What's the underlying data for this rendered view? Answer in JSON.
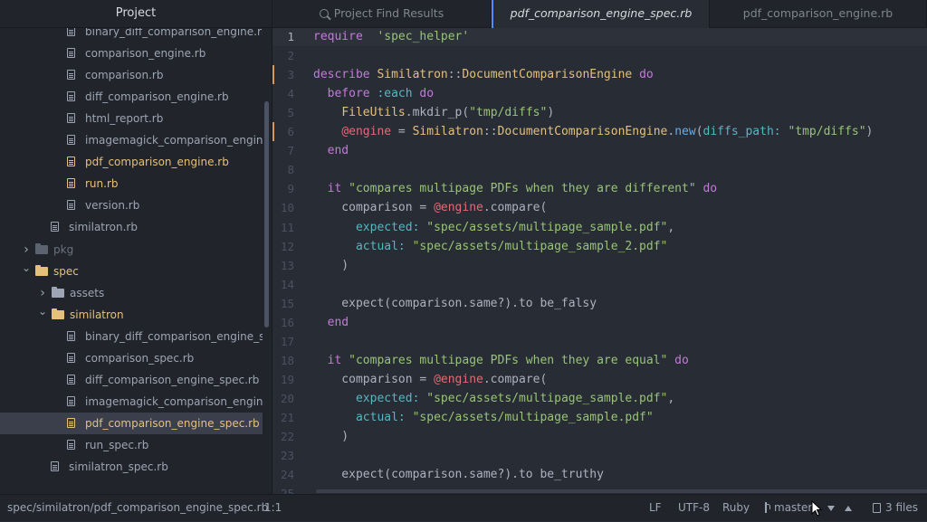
{
  "sidebar": {
    "title": "Project",
    "items": [
      {
        "type": "file",
        "label": "binary_diff_comparison_engine.rb",
        "depth": 3,
        "state": "normal"
      },
      {
        "type": "file",
        "label": "comparison_engine.rb",
        "depth": 3,
        "state": "normal"
      },
      {
        "type": "file",
        "label": "comparison.rb",
        "depth": 3,
        "state": "normal"
      },
      {
        "type": "file",
        "label": "diff_comparison_engine.rb",
        "depth": 3,
        "state": "normal"
      },
      {
        "type": "file",
        "label": "html_report.rb",
        "depth": 3,
        "state": "normal"
      },
      {
        "type": "file",
        "label": "imagemagick_comparison_engine.rt",
        "depth": 3,
        "state": "normal"
      },
      {
        "type": "file",
        "label": "pdf_comparison_engine.rb",
        "depth": 3,
        "state": "modified"
      },
      {
        "type": "file",
        "label": "run.rb",
        "depth": 3,
        "state": "modified"
      },
      {
        "type": "file",
        "label": "version.rb",
        "depth": 3,
        "state": "normal"
      },
      {
        "type": "file",
        "label": "similatron.rb",
        "depth": 2,
        "state": "normal"
      },
      {
        "type": "folder",
        "label": "pkg",
        "depth": 1,
        "expanded": false,
        "state": "ignored"
      },
      {
        "type": "folder",
        "label": "spec",
        "depth": 1,
        "expanded": true,
        "state": "modified"
      },
      {
        "type": "folder",
        "label": "assets",
        "depth": 2,
        "expanded": false,
        "state": "normal"
      },
      {
        "type": "folder",
        "label": "similatron",
        "depth": 2,
        "expanded": true,
        "state": "modified"
      },
      {
        "type": "file",
        "label": "binary_diff_comparison_engine_spe",
        "depth": 3,
        "state": "normal"
      },
      {
        "type": "file",
        "label": "comparison_spec.rb",
        "depth": 3,
        "state": "normal"
      },
      {
        "type": "file",
        "label": "diff_comparison_engine_spec.rb",
        "depth": 3,
        "state": "normal"
      },
      {
        "type": "file",
        "label": "imagemagick_comparison_engine_s",
        "depth": 3,
        "state": "normal"
      },
      {
        "type": "file",
        "label": "pdf_comparison_engine_spec.rb",
        "depth": 3,
        "state": "modified",
        "selected": true
      },
      {
        "type": "file",
        "label": "run_spec.rb",
        "depth": 3,
        "state": "normal"
      },
      {
        "type": "file",
        "label": "similatron_spec.rb",
        "depth": 2,
        "state": "normal"
      }
    ]
  },
  "tabs": [
    {
      "label": "Project Find Results",
      "icon": "search-icon",
      "active": false
    },
    {
      "label": "pdf_comparison_engine_spec.rb",
      "active": true
    },
    {
      "label": "pdf_comparison_engine.rb",
      "active": false
    }
  ],
  "editor": {
    "current_line": 1,
    "modified_lines": [
      3,
      6
    ],
    "lines": [
      [
        [
          "k",
          "require"
        ],
        [
          "",
          "  "
        ],
        [
          "s",
          "'spec_helper'"
        ]
      ],
      [],
      [
        [
          "k",
          "describe"
        ],
        [
          "",
          " "
        ],
        [
          "c",
          "Similatron"
        ],
        [
          "",
          "::"
        ],
        [
          "c",
          "DocumentComparisonEngine"
        ],
        [
          "",
          " "
        ],
        [
          "k",
          "do"
        ]
      ],
      [
        [
          "",
          "  "
        ],
        [
          "k",
          "before"
        ],
        [
          "",
          " "
        ],
        [
          "sym",
          ":each"
        ],
        [
          "",
          " "
        ],
        [
          "k",
          "do"
        ]
      ],
      [
        [
          "",
          "    "
        ],
        [
          "c",
          "FileUtils"
        ],
        [
          "",
          ".mkdir_p("
        ],
        [
          "s",
          "\"tmp/diffs\""
        ],
        [
          "",
          ")"
        ]
      ],
      [
        [
          "",
          "    "
        ],
        [
          "iv",
          "@engine"
        ],
        [
          "",
          " = "
        ],
        [
          "c",
          "Similatron"
        ],
        [
          "",
          "::"
        ],
        [
          "c",
          "DocumentComparisonEngine"
        ],
        [
          "",
          "."
        ],
        [
          "fn",
          "new"
        ],
        [
          "",
          "("
        ],
        [
          "sym",
          "diffs_path:"
        ],
        [
          "",
          " "
        ],
        [
          "s",
          "\"tmp/diffs\""
        ],
        [
          "",
          ")"
        ]
      ],
      [
        [
          "",
          "  "
        ],
        [
          "k",
          "end"
        ]
      ],
      [],
      [
        [
          "",
          "  "
        ],
        [
          "k",
          "it"
        ],
        [
          "",
          " "
        ],
        [
          "s",
          "\"compares multipage PDFs when they are different\""
        ],
        [
          "",
          " "
        ],
        [
          "k",
          "do"
        ]
      ],
      [
        [
          "",
          "    comparison = "
        ],
        [
          "iv",
          "@engine"
        ],
        [
          "",
          ".compare("
        ]
      ],
      [
        [
          "",
          "      "
        ],
        [
          "sym",
          "expected:"
        ],
        [
          "",
          " "
        ],
        [
          "s",
          "\"spec/assets/multipage_sample.pdf\""
        ],
        [
          "",
          ","
        ]
      ],
      [
        [
          "",
          "      "
        ],
        [
          "sym",
          "actual:"
        ],
        [
          "",
          " "
        ],
        [
          "s",
          "\"spec/assets/multipage_sample_2.pdf\""
        ]
      ],
      [
        [
          "",
          "    )"
        ]
      ],
      [],
      [
        [
          "",
          "    expect(comparison.same?).to be_falsy"
        ]
      ],
      [
        [
          "",
          "  "
        ],
        [
          "k",
          "end"
        ]
      ],
      [],
      [
        [
          "",
          "  "
        ],
        [
          "k",
          "it"
        ],
        [
          "",
          " "
        ],
        [
          "s",
          "\"compares multipage PDFs when they are equal\""
        ],
        [
          "",
          " "
        ],
        [
          "k",
          "do"
        ]
      ],
      [
        [
          "",
          "    comparison = "
        ],
        [
          "iv",
          "@engine"
        ],
        [
          "",
          ".compare("
        ]
      ],
      [
        [
          "",
          "      "
        ],
        [
          "sym",
          "expected:"
        ],
        [
          "",
          " "
        ],
        [
          "s",
          "\"spec/assets/multipage_sample.pdf\""
        ],
        [
          "",
          ","
        ]
      ],
      [
        [
          "",
          "      "
        ],
        [
          "sym",
          "actual:"
        ],
        [
          "",
          " "
        ],
        [
          "s",
          "\"spec/assets/multipage_sample.pdf\""
        ]
      ],
      [
        [
          "",
          "    )"
        ]
      ],
      [],
      [
        [
          "",
          "    expect(comparison.same?).to be_truthy"
        ]
      ],
      []
    ]
  },
  "statusbar": {
    "path": "spec/similatron/pdf_comparison_engine_spec.rb",
    "cursor": "1:1",
    "line_ending": "LF",
    "encoding": "UTF-8",
    "grammar": "Ruby",
    "branch": "master",
    "files": "3 files"
  },
  "colors": {
    "modified": "#e5c07b",
    "accent": "#528bff",
    "keyword": "#c678dd",
    "string": "#98c379"
  }
}
